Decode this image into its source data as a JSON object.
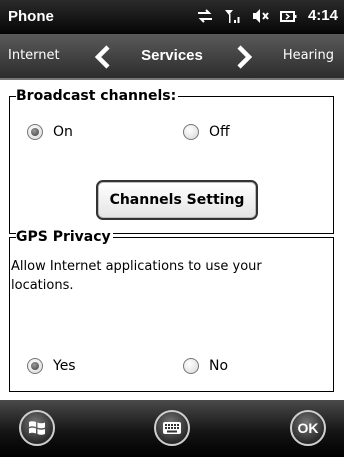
{
  "status_bar": {
    "title": "Phone",
    "time": "4:14"
  },
  "tab_nav": {
    "previous": "Internet",
    "current": "Services",
    "next": "Hearing"
  },
  "broadcast": {
    "label": "Broadcast channels:",
    "options": [
      {
        "label": "On",
        "selected": true
      },
      {
        "label": "Off",
        "selected": false
      }
    ],
    "button_label": "Channels Setting"
  },
  "gps": {
    "label": "GPS Privacy",
    "description": "Allow Internet applications to use your locations.",
    "options": [
      {
        "label": "Yes",
        "selected": true
      },
      {
        "label": "No",
        "selected": false
      }
    ]
  },
  "softkeys": {
    "ok": "OK",
    "icons": [
      "windows-start-icon",
      "keyboard-icon"
    ]
  }
}
